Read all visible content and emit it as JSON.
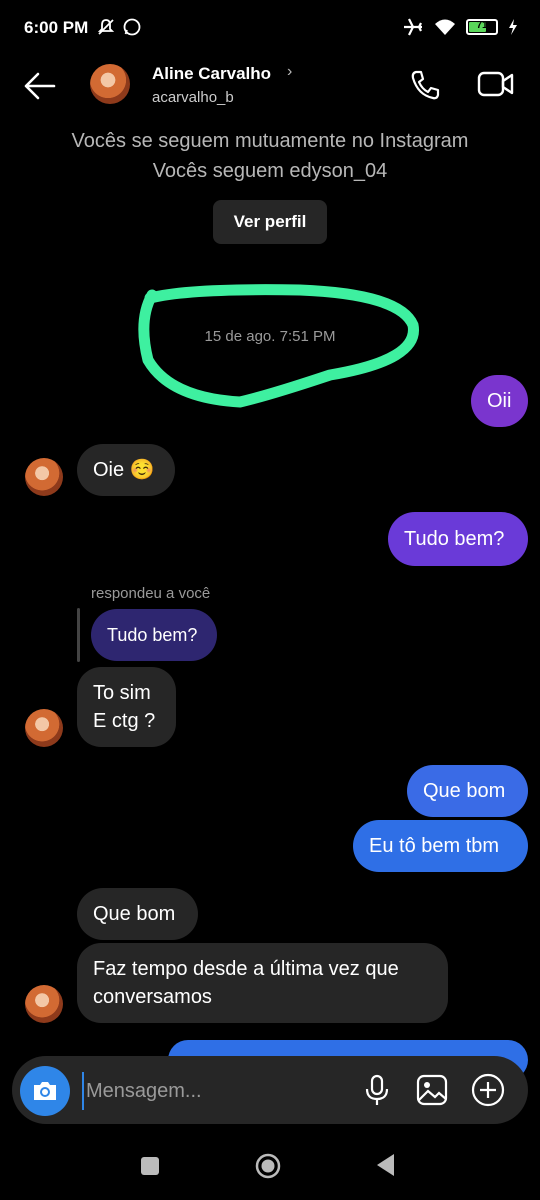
{
  "status_bar": {
    "time": "6:00 PM",
    "battery_level": "71"
  },
  "header": {
    "name": "Aline Carvalho",
    "chevron": "›",
    "handle": "acarvalho_b"
  },
  "info": {
    "line1": "Vocês se seguem mutuamente no Instagram",
    "line2": "Vocês seguem edyson_04",
    "button": "Ver perfil"
  },
  "timestamp": "15 de ago. 7:51 PM",
  "messages": [
    {
      "side": "out",
      "text": "Oii"
    },
    {
      "side": "in",
      "text": "Oie ☺️"
    },
    {
      "side": "out",
      "text": "Tudo bem?"
    },
    {
      "side": "in",
      "replied_label": "respondeu a você",
      "quoted": "Tudo bem?",
      "line1": "To sim",
      "line2": "E ctg ?"
    },
    {
      "side": "out",
      "text": "Que bom"
    },
    {
      "side": "out",
      "text": "Eu tô bem tbm"
    },
    {
      "side": "in",
      "text": "Que bom"
    },
    {
      "side": "in",
      "line1": "Faz tempo desde a última vez que",
      "line2": "conversamos"
    }
  ],
  "composer": {
    "placeholder": "Mensagem..."
  },
  "colors": {
    "accent_purple": "#7a35ce",
    "accent_blue": "#2f6fe6",
    "highlight": "#3ef0a0"
  },
  "icons": [
    "back-arrow-icon",
    "chevron-right-icon",
    "phone-icon",
    "video-camera-icon",
    "camera-icon",
    "microphone-icon",
    "gallery-icon",
    "plus-icon",
    "airplane-icon",
    "wifi-icon",
    "battery-icon"
  ]
}
